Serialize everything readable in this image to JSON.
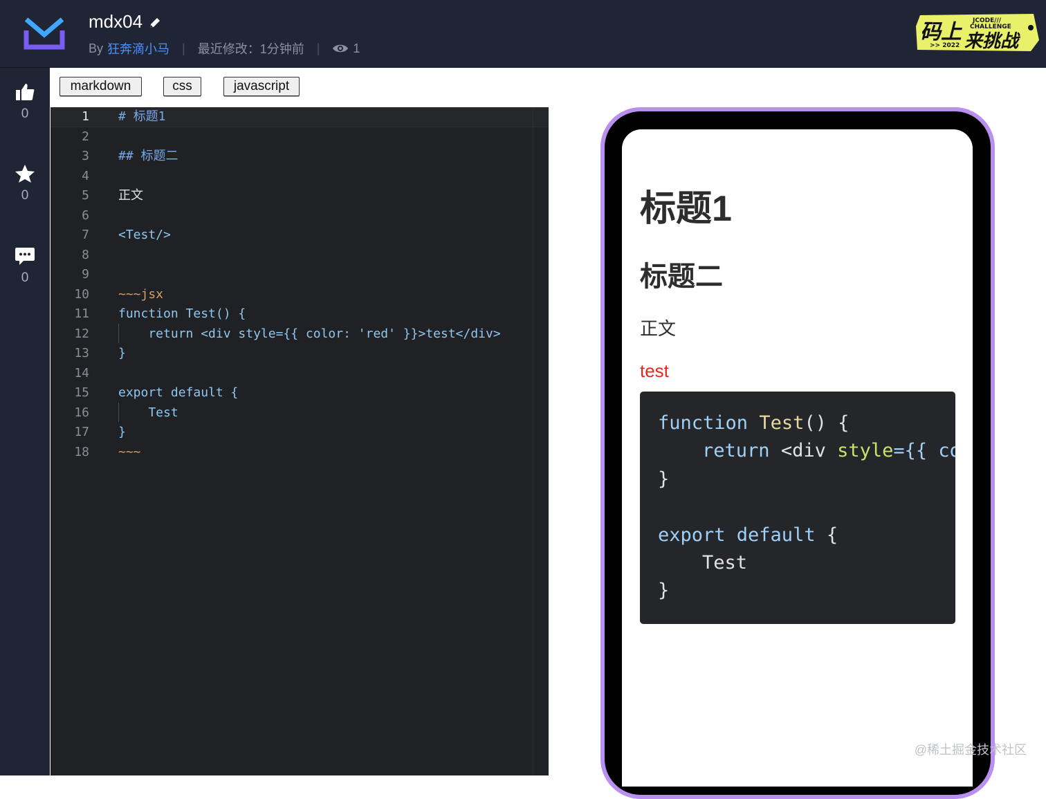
{
  "header": {
    "title": "mdx04",
    "by_label": "By",
    "author": "狂奔滴小马",
    "separator": "|",
    "modified": "最近修改：1分钟前",
    "views": "1",
    "badge": {
      "line1": "码上",
      "line2": "来挑战",
      "small1": "JCODE///",
      "small2": "CHALLENGE",
      "year": ">> 2022"
    }
  },
  "sidebar": {
    "like_count": "0",
    "star_count": "0",
    "comment_count": "0"
  },
  "tabs": [
    "markdown",
    "css",
    "javascript"
  ],
  "editor": {
    "line_numbers": [
      "1",
      "2",
      "3",
      "4",
      "5",
      "6",
      "7",
      "8",
      "9",
      "10",
      "11",
      "12",
      "13",
      "14",
      "15",
      "16",
      "17",
      "18"
    ],
    "lines": [
      {
        "text": "# 标题1",
        "kind": "head"
      },
      {
        "text": "",
        "kind": "plain"
      },
      {
        "text": "## 标题二",
        "kind": "head"
      },
      {
        "text": "",
        "kind": "plain"
      },
      {
        "text": "正文",
        "kind": "plain"
      },
      {
        "text": "",
        "kind": "plain"
      },
      {
        "text": "<Test/>",
        "kind": "tag"
      },
      {
        "text": "",
        "kind": "plain"
      },
      {
        "text": "",
        "kind": "plain"
      },
      {
        "text": "~~~jsx",
        "kind": "fence"
      },
      {
        "text": "function Test() {",
        "kind": "code"
      },
      {
        "text": "    return <div style={{ color: 'red' }}>test</div>",
        "kind": "code"
      },
      {
        "text": "}",
        "kind": "code"
      },
      {
        "text": "",
        "kind": "plain"
      },
      {
        "text": "export default {",
        "kind": "code"
      },
      {
        "text": "    Test",
        "kind": "code"
      },
      {
        "text": "}",
        "kind": "code"
      },
      {
        "text": "~~~",
        "kind": "fence"
      }
    ]
  },
  "preview": {
    "h1": "标题1",
    "h2": "标题二",
    "body": "正文",
    "test_output": "test",
    "code": {
      "l1_kw": "function",
      "l1_fn": "Test",
      "l1_rest": "() {",
      "l2_kw": "return",
      "l2_tag": "<div",
      "l2_attr": "style",
      "l2_rest": "={{ co",
      "l3": "}",
      "l5_kw": "export default",
      "l5_rest": " {",
      "l6": "Test",
      "l7": "}"
    }
  },
  "watermark": "@稀土掘金技术社区",
  "colors": {
    "header_bg": "#1f2534",
    "editor_bg": "#202124",
    "phone_frame": "#b98ff0",
    "author_link": "#4a90ff",
    "test_red": "#e8271c"
  }
}
